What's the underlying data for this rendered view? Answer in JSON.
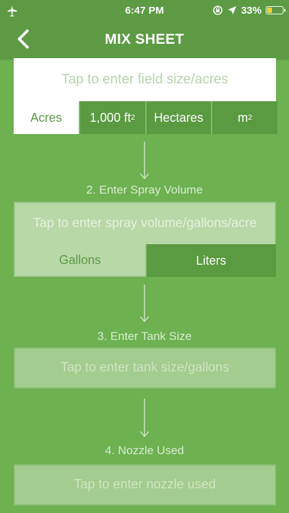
{
  "status": {
    "time": "6:47 PM",
    "battery_percent": "33%",
    "battery_level": 0.33,
    "icons": [
      "airplane-icon",
      "orientation-lock-icon",
      "location-arrow-icon",
      "battery-icon"
    ]
  },
  "nav": {
    "title": "MIX SHEET",
    "back_icon": "chevron-left-icon"
  },
  "field": {
    "placeholder": "Tap to enter field size/acres",
    "units": [
      {
        "label": "Acres",
        "selected": true
      },
      {
        "label": "1,000 ft",
        "sup": "2",
        "selected": false
      },
      {
        "label": "Hectares",
        "selected": false
      },
      {
        "label": "m",
        "sup": "2",
        "selected": false
      }
    ]
  },
  "spray": {
    "label": "2. Enter Spray Volume",
    "placeholder": "Tap to enter spray volume/gallons/acre",
    "units": [
      {
        "label": "Gallons",
        "selected": true
      },
      {
        "label": "Liters",
        "selected": false
      }
    ]
  },
  "tank": {
    "label": "3. Enter Tank Size",
    "placeholder": "Tap to enter tank size/gallons"
  },
  "nozzle": {
    "label": "4. Nozzle Used",
    "placeholder": "Tap to enter nozzle used"
  },
  "colors": {
    "background": "#6db151",
    "header": "#5d9a44",
    "selected_text": "#5d9a44",
    "battery_fill": "#f3d23a"
  }
}
